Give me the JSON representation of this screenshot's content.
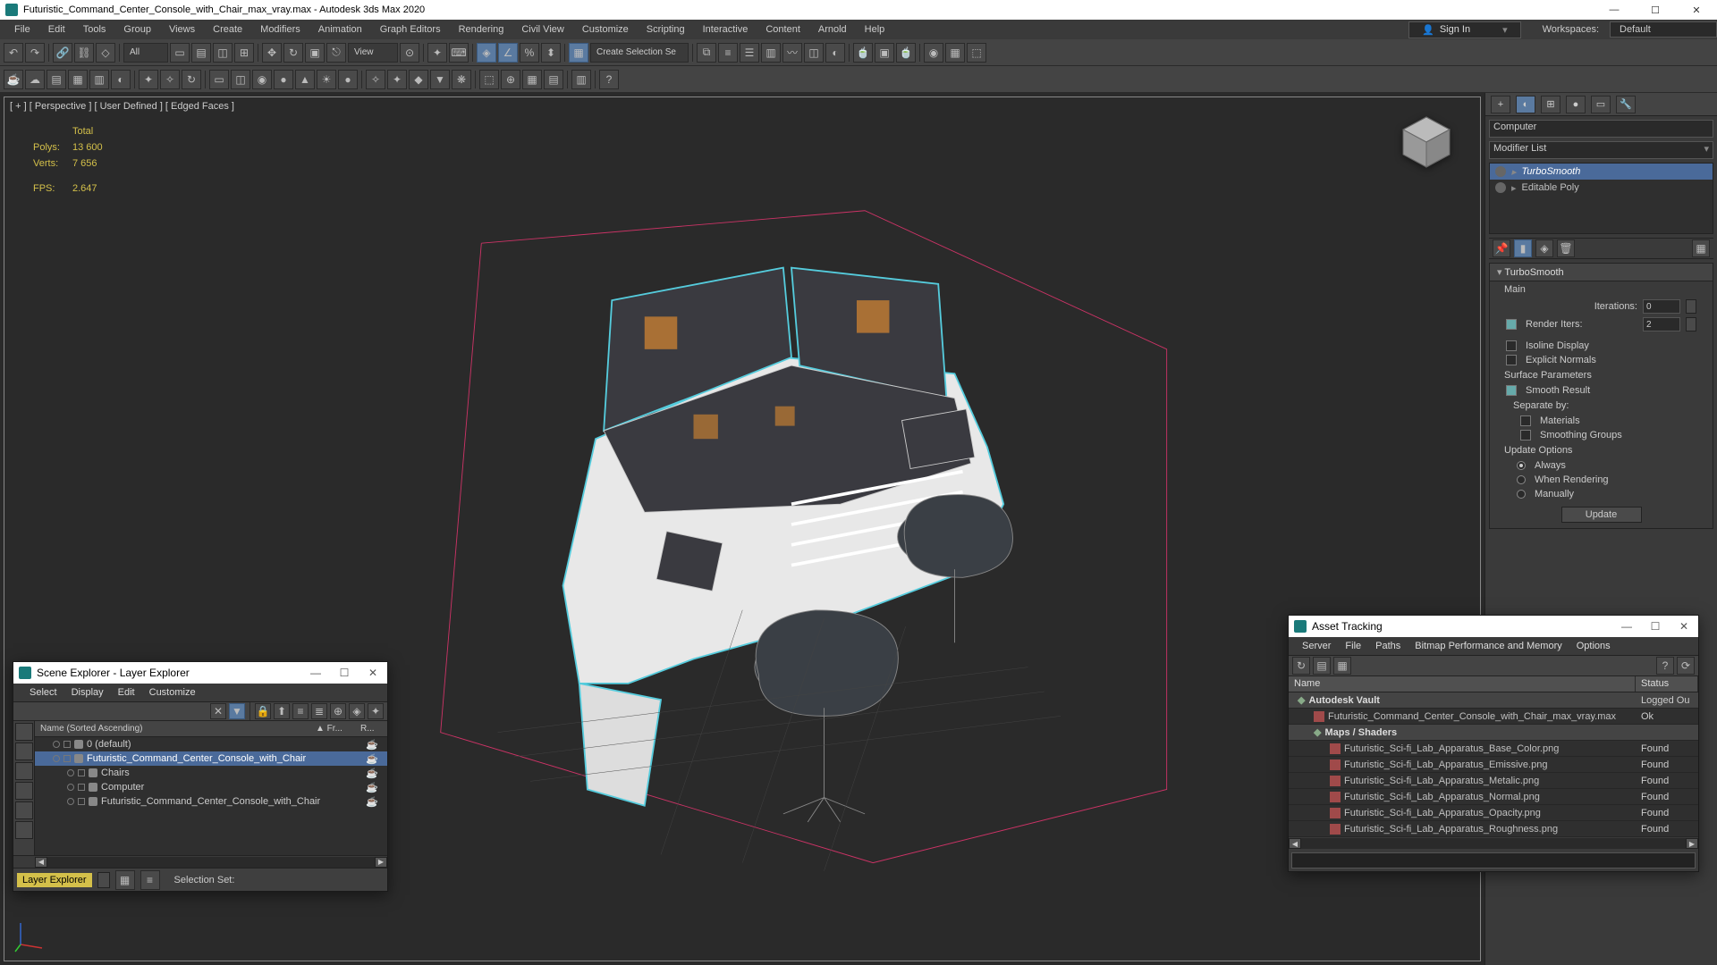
{
  "title": "Futuristic_Command_Center_Console_with_Chair_max_vray.max - Autodesk 3ds Max 2020",
  "menubar": [
    "File",
    "Edit",
    "Tools",
    "Group",
    "Views",
    "Create",
    "Modifiers",
    "Animation",
    "Graph Editors",
    "Rendering",
    "Civil View",
    "Customize",
    "Scripting",
    "Interactive",
    "Content",
    "Arnold",
    "Help"
  ],
  "signin": "Sign In",
  "workspaces_label": "Workspaces:",
  "workspaces_value": "Default",
  "toolbar_all": "All",
  "toolbar_view": "View",
  "toolbar_create_sel": "Create Selection Se",
  "viewport_label": "[ + ] [ Perspective ] [ User Defined ] [ Edged Faces ]",
  "stats": {
    "total": "Total",
    "polys_l": "Polys:",
    "polys_v": "13 600",
    "verts_l": "Verts:",
    "verts_v": "7 656",
    "fps_l": "FPS:",
    "fps_v": "2.647"
  },
  "cmd": {
    "object_name": "Computer",
    "modifier_list": "Modifier List",
    "stack": [
      {
        "name": "TurboSmooth",
        "sel": true,
        "italic": true
      },
      {
        "name": "Editable Poly",
        "sel": false
      }
    ],
    "rollout_title": "TurboSmooth",
    "main": "Main",
    "iterations_l": "Iterations:",
    "iterations_v": "0",
    "render_iters_l": "Render Iters:",
    "render_iters_v": "2",
    "render_iters_chk": true,
    "isoline": "Isoline Display",
    "explicit": "Explicit Normals",
    "surface_params": "Surface Parameters",
    "smooth_result": "Smooth Result",
    "separate_by": "Separate by:",
    "materials": "Materials",
    "smoothing_groups": "Smoothing Groups",
    "update_options": "Update Options",
    "always": "Always",
    "when_rendering": "When Rendering",
    "manually": "Manually",
    "update_btn": "Update"
  },
  "scene_explorer": {
    "title": "Scene Explorer - Layer Explorer",
    "menus": [
      "Select",
      "Display",
      "Edit",
      "Customize"
    ],
    "hdr_name": "Name (Sorted Ascending)",
    "hdr_frozen": "▲ Fr...",
    "hdr_r": "R...",
    "rows": [
      {
        "indent": 0,
        "name": "0 (default)",
        "sel": false
      },
      {
        "indent": 0,
        "name": "Futuristic_Command_Center_Console_with_Chair",
        "sel": true
      },
      {
        "indent": 1,
        "name": "Chairs",
        "sel": false
      },
      {
        "indent": 1,
        "name": "Computer",
        "sel": false
      },
      {
        "indent": 1,
        "name": "Futuristic_Command_Center_Console_with_Chair",
        "sel": false
      }
    ],
    "footer": "Layer Explorer",
    "selection_set": "Selection Set:"
  },
  "asset_tracking": {
    "title": "Asset Tracking",
    "menus": [
      "Server",
      "File",
      "Paths",
      "Bitmap Performance and Memory",
      "Options"
    ],
    "hdr_name": "Name",
    "hdr_status": "Status",
    "rows": [
      {
        "group": true,
        "indent": 0,
        "name": "Autodesk Vault",
        "status": "Logged Ou"
      },
      {
        "group": false,
        "indent": 1,
        "name": "Futuristic_Command_Center_Console_with_Chair_max_vray.max",
        "status": "Ok"
      },
      {
        "group": true,
        "indent": 1,
        "name": "Maps / Shaders",
        "status": ""
      },
      {
        "group": false,
        "indent": 2,
        "name": "Futuristic_Sci-fi_Lab_Apparatus_Base_Color.png",
        "status": "Found"
      },
      {
        "group": false,
        "indent": 2,
        "name": "Futuristic_Sci-fi_Lab_Apparatus_Emissive.png",
        "status": "Found"
      },
      {
        "group": false,
        "indent": 2,
        "name": "Futuristic_Sci-fi_Lab_Apparatus_Metalic.png",
        "status": "Found"
      },
      {
        "group": false,
        "indent": 2,
        "name": "Futuristic_Sci-fi_Lab_Apparatus_Normal.png",
        "status": "Found"
      },
      {
        "group": false,
        "indent": 2,
        "name": "Futuristic_Sci-fi_Lab_Apparatus_Opacity.png",
        "status": "Found"
      },
      {
        "group": false,
        "indent": 2,
        "name": "Futuristic_Sci-fi_Lab_Apparatus_Roughness.png",
        "status": "Found"
      }
    ]
  }
}
